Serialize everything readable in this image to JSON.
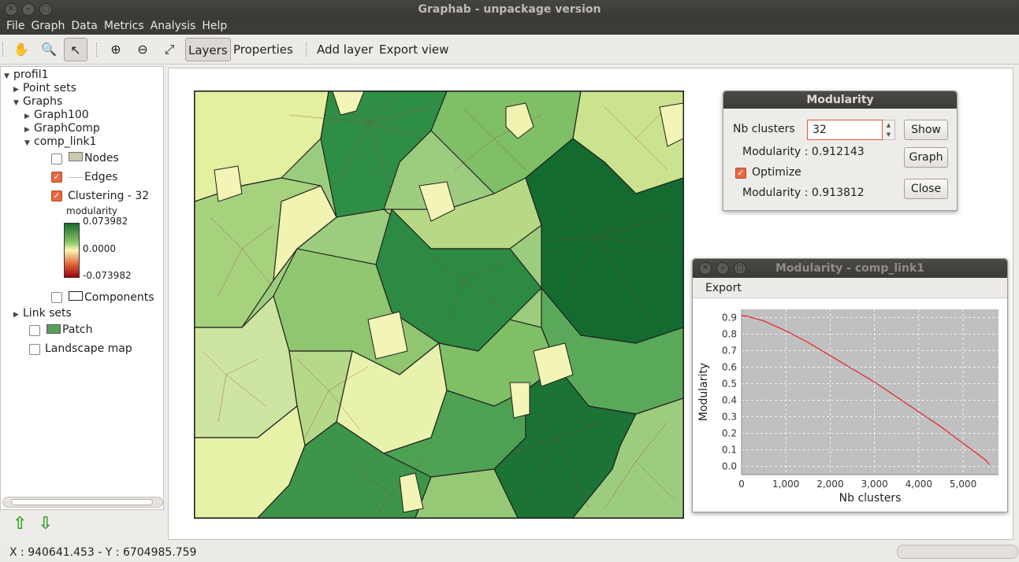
{
  "window": {
    "title": "Graphab - unpackage version"
  },
  "menu": [
    "File",
    "Graph",
    "Data",
    "Metrics",
    "Analysis",
    "Help"
  ],
  "toolbar": {
    "layers": "Layers",
    "properties": "Properties",
    "add_layer": "Add layer",
    "export_view": "Export view"
  },
  "tree": {
    "root": "profil1",
    "point_sets": "Point sets",
    "graphs": "Graphs",
    "graph100": "Graph100",
    "graphcomp": "GraphComp",
    "comp_link1": "comp_link1",
    "nodes": "Nodes",
    "edges": "Edges",
    "clustering": "Clustering - 32",
    "legend_title": "modularity",
    "legend_max": "0.073982",
    "legend_mid": "0.0000",
    "legend_min": "-0.073982",
    "components": "Components",
    "link_sets": "Link sets",
    "patch": "Patch",
    "landscape_map": "Landscape map"
  },
  "modularity_dialog": {
    "title": "Modularity",
    "nb_clusters_label": "Nb clusters",
    "nb_clusters_value": "32",
    "modularity_1": "Modularity : 0.912143",
    "optimize_label": "Optimize",
    "modularity_2": "Modularity : 0.913812",
    "show": "Show",
    "graph": "Graph",
    "close": "Close"
  },
  "chart_window": {
    "title": "Modularity - comp_link1",
    "export": "Export"
  },
  "chart_data": {
    "type": "line",
    "xlabel": "Nb clusters",
    "ylabel": "Modularity",
    "xlim": [
      0,
      5800
    ],
    "ylim": [
      -0.05,
      0.95
    ],
    "x_ticks": [
      "0",
      "1,000",
      "2,000",
      "3,000",
      "4,000",
      "5,000"
    ],
    "y_ticks": [
      "0.0",
      "0.1",
      "0.2",
      "0.3",
      "0.4",
      "0.5",
      "0.6",
      "0.7",
      "0.8",
      "0.9"
    ],
    "series": [
      {
        "color": "#e0262a",
        "x": [
          0,
          100,
          500,
          1000,
          1500,
          2000,
          2500,
          3000,
          3500,
          4000,
          4500,
          5000,
          5500,
          5600
        ],
        "y": [
          0.91,
          0.91,
          0.88,
          0.82,
          0.75,
          0.67,
          0.59,
          0.51,
          0.42,
          0.33,
          0.24,
          0.14,
          0.04,
          0.01
        ]
      }
    ],
    "grid": true
  },
  "status": {
    "coords": "X : 940641.453 - Y : 6704985.759"
  }
}
